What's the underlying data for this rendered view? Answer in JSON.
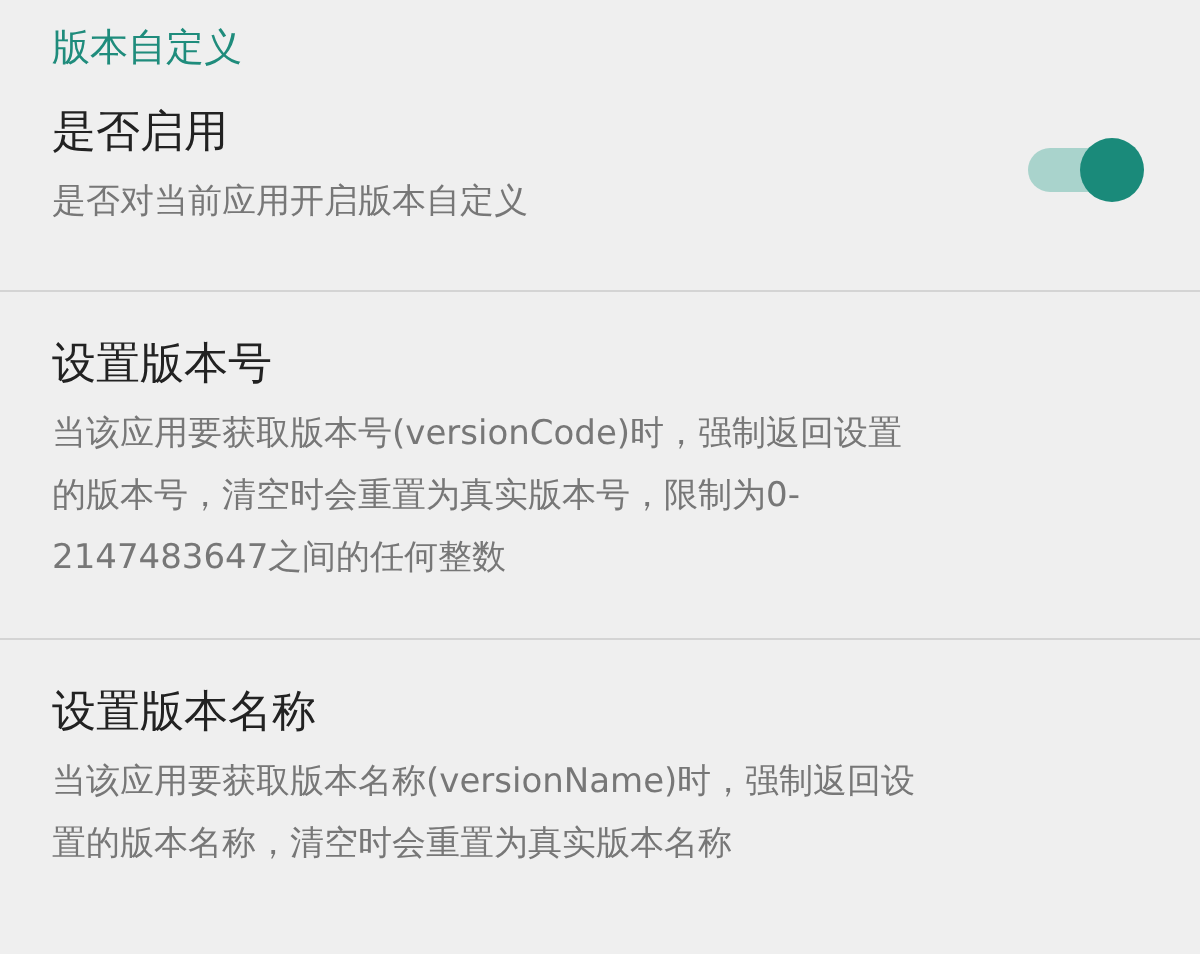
{
  "section_title": "版本自定义",
  "items": [
    {
      "kind": "switch",
      "title": "是否启用",
      "summary": "是否对当前应用开启版本自定义",
      "on": true
    },
    {
      "kind": "text",
      "title": "设置版本号",
      "summary": "当该应用要获取版本号(versionCode)时，强制返回设置的版本号，清空时会重置为真实版本号，限制为0-2147483647之间的任何整数"
    },
    {
      "kind": "text",
      "title": "设置版本名称",
      "summary": "当该应用要获取版本名称(versionName)时，强制返回设置的版本名称，清空时会重置为真实版本名称"
    }
  ]
}
